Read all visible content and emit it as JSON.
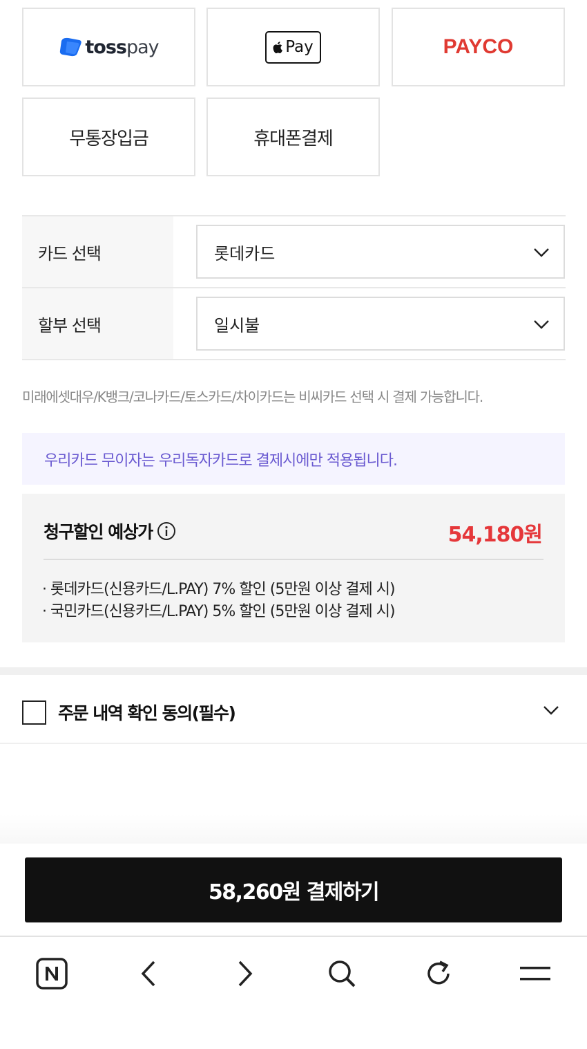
{
  "payment_methods": {
    "tosspay": {
      "label_bold": "toss",
      "label_light": "pay",
      "icon": "tosspay-logo-icon"
    },
    "applepay": {
      "label": "Pay",
      "icon": "apple-icon"
    },
    "payco": {
      "label": "PAYCO"
    },
    "bank_transfer": {
      "label": "무통장입금"
    },
    "mobile_payment": {
      "label": "휴대폰결제"
    }
  },
  "card_select": {
    "label": "카드 선택",
    "value": "롯데카드",
    "icon": "chevron-down-icon"
  },
  "installment_select": {
    "label": "할부 선택",
    "value": "일시불",
    "icon": "chevron-down-icon"
  },
  "notice": "미래에셋대우/K뱅크/코나카드/토스카드/차이카드는 비씨카드 선택 시 결제 가능합니다.",
  "woori_notice": "우리카드 무이자는 우리독자카드로 결제시에만 적용됩니다.",
  "discount": {
    "title": "청구할인 예상가",
    "info_icon": "info-icon",
    "price": "54,180원",
    "items": [
      "· 롯데카드(신용카드/L.PAY) 7% 할인 (5만원 이상 결제 시)",
      "· 국민카드(신용카드/L.PAY) 5% 할인 (5만원 이상 결제 시)"
    ]
  },
  "agreement": {
    "label": "주문 내역 확인 동의(필수)",
    "checked": false
  },
  "pay_button": {
    "label": "58,260원 결제하기"
  },
  "browser_nav": [
    "naver-home-icon",
    "back-icon",
    "forward-icon",
    "search-icon",
    "refresh-icon",
    "menu-icon"
  ],
  "colors": {
    "accent_red": "#e5373a",
    "payco_red": "#e03a32",
    "purple_text": "#6a5ad1",
    "purple_bg": "#f5f4ff",
    "pay_button_bg": "#111111"
  }
}
